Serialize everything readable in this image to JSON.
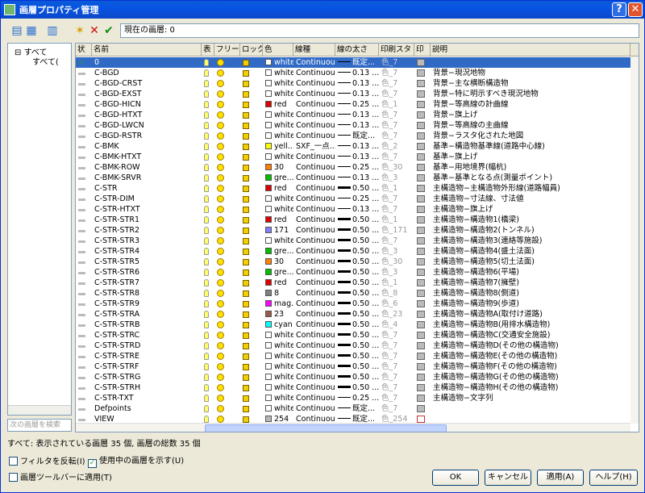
{
  "window": {
    "title": "画層プロパティ管理",
    "help_glyph": "?",
    "close_glyph": "✕"
  },
  "toolbar": {
    "current_layer_label": "現在の画層: 0",
    "icons": [
      "new-property-filter-icon",
      "new-group-filter-icon",
      "layer-states-icon",
      "new-layer-icon",
      "delete-layer-icon",
      "set-current-icon"
    ]
  },
  "tree": {
    "root": "すべて",
    "child": "すべて("
  },
  "search": {
    "placeholder": "次の画層を検索"
  },
  "columns": [
    "状",
    "名前",
    "表",
    "フリーズ",
    "ロック",
    "色",
    "線種",
    "線の太さ",
    "印刷スタ",
    "印",
    "説明"
  ],
  "rows": [
    {
      "name": "0",
      "color": "white",
      "hex": "#ffffff",
      "lt": "Continuous",
      "lw": "既定...",
      "thick": false,
      "ps": "色_7",
      "desc": "",
      "cur": true
    },
    {
      "name": "C-BGD",
      "color": "white",
      "hex": "#ffffff",
      "lt": "Continuous",
      "lw": "0.13 ...",
      "thick": false,
      "ps": "色_7",
      "desc": "背景−現況地物"
    },
    {
      "name": "C-BGD-CRST",
      "color": "white",
      "hex": "#ffffff",
      "lt": "Continuous",
      "lw": "0.13 ...",
      "thick": false,
      "ps": "色_7",
      "desc": "背景−主な横断構造物"
    },
    {
      "name": "C-BGD-EXST",
      "color": "white",
      "hex": "#ffffff",
      "lt": "Continuous",
      "lw": "0.13 ...",
      "thick": false,
      "ps": "色_7",
      "desc": "背景−特に明示すべき現況地物"
    },
    {
      "name": "C-BGD-HICN",
      "color": "red",
      "hex": "#e00000",
      "lt": "Continuous",
      "lw": "0.25 ...",
      "thick": false,
      "ps": "色_1",
      "desc": "背景−等高線の計曲線"
    },
    {
      "name": "C-BGD-HTXT",
      "color": "white",
      "hex": "#ffffff",
      "lt": "Continuous",
      "lw": "0.13 ...",
      "thick": false,
      "ps": "色_7",
      "desc": "背景−旗上げ"
    },
    {
      "name": "C-BGD-LWCN",
      "color": "white",
      "hex": "#ffffff",
      "lt": "Continuous",
      "lw": "0.13 ...",
      "thick": false,
      "ps": "色_7",
      "desc": "背景−等高線の主曲線"
    },
    {
      "name": "C-BGD-RSTR",
      "color": "white",
      "hex": "#ffffff",
      "lt": "Continuous",
      "lw": "既定...",
      "thick": false,
      "ps": "色_7",
      "desc": "背景−ラスタ化された地図"
    },
    {
      "name": "C-BMK",
      "color": "yell...",
      "hex": "#ffff00",
      "lt": "SXF_一点...",
      "lw": "0.13 ...",
      "thick": false,
      "ps": "色_2",
      "desc": "基準−構造物基準線(道路中心線)"
    },
    {
      "name": "C-BMK-HTXT",
      "color": "white",
      "hex": "#ffffff",
      "lt": "Continuous",
      "lw": "0.13 ...",
      "thick": false,
      "ps": "色_7",
      "desc": "基準−旗上げ"
    },
    {
      "name": "C-BMK-ROW",
      "color": "30",
      "hex": "#ff7f00",
      "lt": "Continuous",
      "lw": "0.25 ...",
      "thick": false,
      "ps": "色_30",
      "desc": "基準−用地境界(幅杭)"
    },
    {
      "name": "C-BMK-SRVR",
      "color": "gre...",
      "hex": "#00c000",
      "lt": "Continuous",
      "lw": "0.13 ...",
      "thick": false,
      "ps": "色_3",
      "desc": "基準−基準となる点(測量ポイント)"
    },
    {
      "name": "C-STR",
      "color": "red",
      "hex": "#e00000",
      "lt": "Continuous",
      "lw": "0.50 ...",
      "thick": true,
      "ps": "色_1",
      "desc": "主構造物−主構造物外形線(道路幅員)"
    },
    {
      "name": "C-STR-DIM",
      "color": "white",
      "hex": "#ffffff",
      "lt": "Continuous",
      "lw": "0.25 ...",
      "thick": false,
      "ps": "色_7",
      "desc": "主構造物−寸法線、寸法値"
    },
    {
      "name": "C-STR-HTXT",
      "color": "white",
      "hex": "#ffffff",
      "lt": "Continuous",
      "lw": "0.13 ...",
      "thick": false,
      "ps": "色_7",
      "desc": "主構造物−旗上げ"
    },
    {
      "name": "C-STR-STR1",
      "color": "red",
      "hex": "#e00000",
      "lt": "Continuous",
      "lw": "0.50 ...",
      "thick": true,
      "ps": "色_1",
      "desc": "主構造物−構造物1(橋梁)"
    },
    {
      "name": "C-STR-STR2",
      "color": "171",
      "hex": "#7f7fff",
      "lt": "Continuous",
      "lw": "0.50 ...",
      "thick": true,
      "ps": "色_171",
      "desc": "主構造物−構造物2(トンネル)"
    },
    {
      "name": "C-STR-STR3",
      "color": "white",
      "hex": "#ffffff",
      "lt": "Continuous",
      "lw": "0.50 ...",
      "thick": true,
      "ps": "色_7",
      "desc": "主構造物−構造物3(連絡等施設)"
    },
    {
      "name": "C-STR-STR4",
      "color": "gre...",
      "hex": "#00c000",
      "lt": "Continuous",
      "lw": "0.50 ...",
      "thick": true,
      "ps": "色_3",
      "desc": "主構造物−構造物4(盛土法面)"
    },
    {
      "name": "C-STR-STR5",
      "color": "30",
      "hex": "#ff7f00",
      "lt": "Continuous",
      "lw": "0.50 ...",
      "thick": true,
      "ps": "色_30",
      "desc": "主構造物−構造物5(切土法面)"
    },
    {
      "name": "C-STR-STR6",
      "color": "gre...",
      "hex": "#00c000",
      "lt": "Continuous",
      "lw": "0.50 ...",
      "thick": true,
      "ps": "色_3",
      "desc": "主構造物−構造物6(平場)"
    },
    {
      "name": "C-STR-STR7",
      "color": "red",
      "hex": "#e00000",
      "lt": "Continuous",
      "lw": "0.50 ...",
      "thick": true,
      "ps": "色_1",
      "desc": "主構造物−構造物7(擁壁)"
    },
    {
      "name": "C-STR-STR8",
      "color": "8",
      "hex": "#808080",
      "lt": "Continuous",
      "lw": "0.50 ...",
      "thick": true,
      "ps": "色_8",
      "desc": "主構造物−構造物8(側道)"
    },
    {
      "name": "C-STR-STR9",
      "color": "mag...",
      "hex": "#ff00ff",
      "lt": "Continuous",
      "lw": "0.50 ...",
      "thick": true,
      "ps": "色_6",
      "desc": "主構造物−構造物9(歩道)"
    },
    {
      "name": "C-STR-STRA",
      "color": "23",
      "hex": "#995c4c",
      "lt": "Continuous",
      "lw": "0.50 ...",
      "thick": true,
      "ps": "色_23",
      "desc": "主構造物−構造物A(取付け道路)"
    },
    {
      "name": "C-STR-STRB",
      "color": "cyan",
      "hex": "#00ffff",
      "lt": "Continuous",
      "lw": "0.50 ...",
      "thick": true,
      "ps": "色_4",
      "desc": "主構造物−構造物B(用排水構造物)"
    },
    {
      "name": "C-STR-STRC",
      "color": "white",
      "hex": "#ffffff",
      "lt": "Continuous",
      "lw": "0.50 ...",
      "thick": true,
      "ps": "色_7",
      "desc": "主構造物−構造物C(交通安全施設)"
    },
    {
      "name": "C-STR-STRD",
      "color": "white",
      "hex": "#ffffff",
      "lt": "Continuous",
      "lw": "0.50 ...",
      "thick": true,
      "ps": "色_7",
      "desc": "主構造物−構造物D(その他の構造物)"
    },
    {
      "name": "C-STR-STRE",
      "color": "white",
      "hex": "#ffffff",
      "lt": "Continuous",
      "lw": "0.50 ...",
      "thick": true,
      "ps": "色_7",
      "desc": "主構造物−構造物E(その他の構造物)"
    },
    {
      "name": "C-STR-STRF",
      "color": "white",
      "hex": "#ffffff",
      "lt": "Continuous",
      "lw": "0.50 ...",
      "thick": true,
      "ps": "色_7",
      "desc": "主構造物−構造物F(その他の構造物)"
    },
    {
      "name": "C-STR-STRG",
      "color": "white",
      "hex": "#ffffff",
      "lt": "Continuous",
      "lw": "0.50 ...",
      "thick": true,
      "ps": "色_7",
      "desc": "主構造物−構造物G(その他の構造物)"
    },
    {
      "name": "C-STR-STRH",
      "color": "white",
      "hex": "#ffffff",
      "lt": "Continuous",
      "lw": "0.50 ...",
      "thick": true,
      "ps": "色_7",
      "desc": "主構造物−構造物H(その他の構造物)"
    },
    {
      "name": "C-STR-TXT",
      "color": "white",
      "hex": "#ffffff",
      "lt": "Continuous",
      "lw": "0.25 ...",
      "thick": false,
      "ps": "色_7",
      "desc": "主構造物−文字列"
    },
    {
      "name": "Defpoints",
      "color": "white",
      "hex": "#ffffff",
      "lt": "Continuous",
      "lw": "既定...",
      "thick": false,
      "ps": "色_7",
      "desc": ""
    },
    {
      "name": "VIEW",
      "color": "254",
      "hex": "#b8b8b8",
      "lt": "Continuous",
      "lw": "既定...",
      "thick": false,
      "ps": "色_254",
      "desc": "",
      "noplot": true
    }
  ],
  "status": {
    "text": "すべて: 表示されている画層 35 個, 画層の総数 35 個"
  },
  "options": {
    "invert_filter": "フィルタを反転(I)",
    "show_used": "使用中の画層を示す(U)",
    "apply_toolbar": "画層ツールバーに適用(T)",
    "check_glyph": "✓"
  },
  "buttons": {
    "ok": "OK",
    "cancel": "キャンセル",
    "apply": "適用(A)",
    "help": "ヘルプ(H)"
  }
}
